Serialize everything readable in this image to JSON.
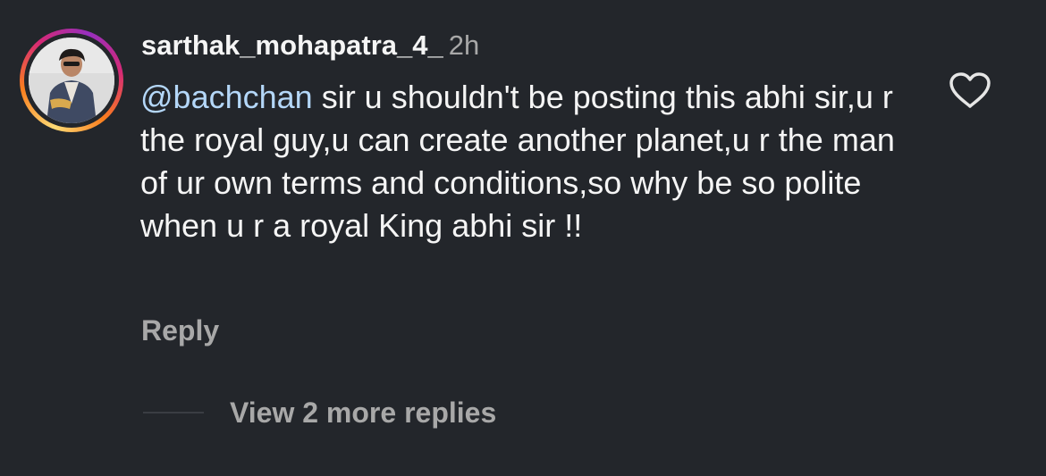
{
  "comment": {
    "username": "sarthak_mohapatra_4_",
    "timestamp": "2h",
    "mention": "@bachchan",
    "text": " sir u shouldn't be posting this abhi sir,u r the royal guy,u can create another planet,u r the man of ur own terms and conditions,so why be so polite when u r a royal King abhi sir !!",
    "reply_label": "Reply",
    "view_more_label": "View 2 more replies",
    "icons": {
      "like": "heart-outline-icon",
      "avatar_ring": "story-ring"
    },
    "colors": {
      "background": "#23262b",
      "text": "#f5f5f5",
      "secondary": "#a8a8a8",
      "mention": "#b4d7f8"
    }
  }
}
